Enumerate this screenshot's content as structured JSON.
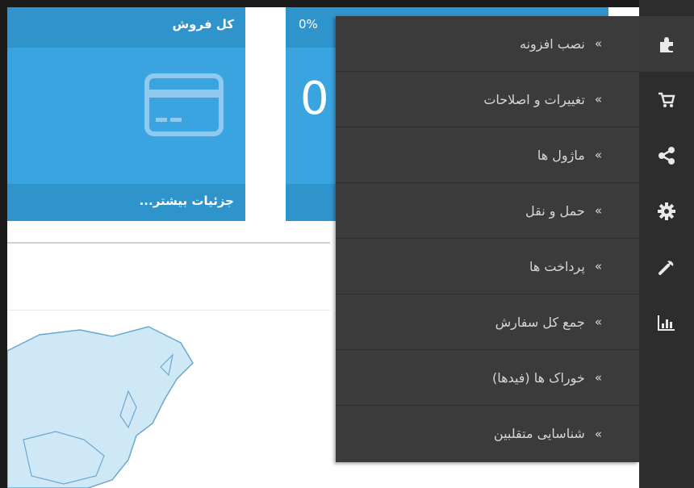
{
  "tiles": {
    "total_sales": {
      "title": "کل فروش",
      "footer_link": "جزئیات بیشتر...",
      "icon": "credit-card-icon"
    },
    "orders": {
      "percent": "0%",
      "value": "0"
    }
  },
  "sidebar": {
    "icons": [
      "puzzle-icon",
      "cart-icon",
      "share-icon",
      "gear-icon",
      "wrench-icon",
      "bar-chart-icon"
    ],
    "active_index": 0
  },
  "flyout_menu": {
    "arrow": "«",
    "items": [
      {
        "label": "نصب افزونه"
      },
      {
        "label": "تغییرات و اصلاحات"
      },
      {
        "label": "ماژول ها"
      },
      {
        "label": "حمل و نقل"
      },
      {
        "label": "پرداخت ها"
      },
      {
        "label": "جمع کل سفارش"
      },
      {
        "label": "خوراک ها (فیدها)"
      },
      {
        "label": "شناسایی متقلبین"
      }
    ]
  },
  "colors": {
    "tile": "#3aa4e0",
    "tile_dark": "#2f93cc",
    "menu_bg": "#3b3b3b",
    "sidebar_bg": "#2d2d2d",
    "map_fill": "#cfe8f6",
    "map_stroke": "#6aa9cf"
  }
}
